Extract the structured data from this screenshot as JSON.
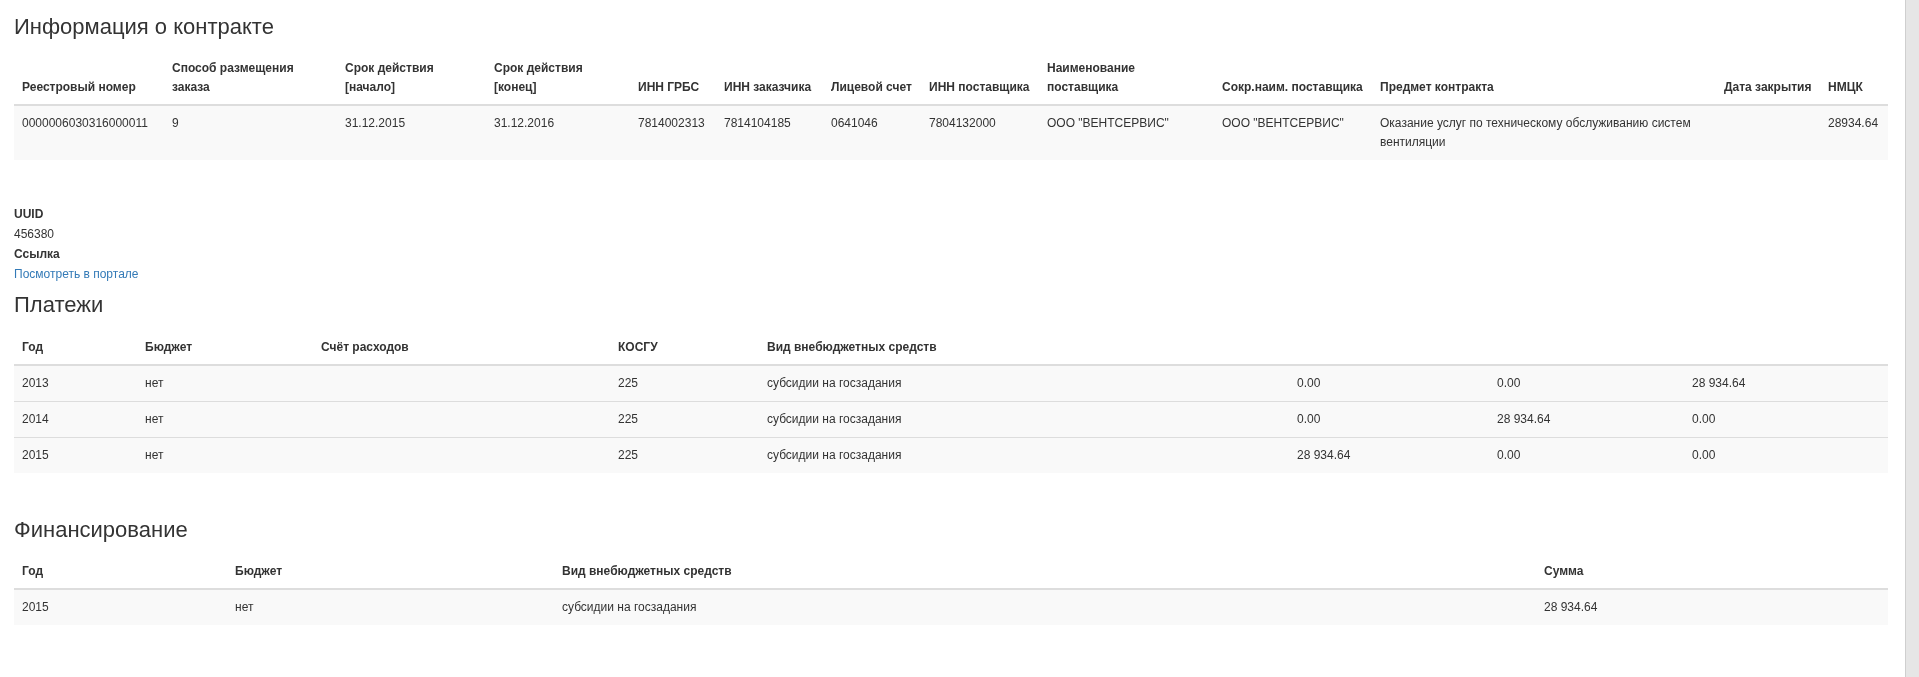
{
  "contract": {
    "title": "Информация о контракте",
    "columns": [
      "Реестровый номер",
      "Способ размещения заказа",
      "Срок действия [начало]",
      "Срок действия [конец]",
      "ИНН ГРБС",
      "ИНН заказчика",
      "Лицевой счет",
      "ИНН поставщика",
      "Наименование поставщика",
      "Сокр.наим. поставщика",
      "Предмет контракта",
      "Дата закрытия",
      "НМЦК"
    ],
    "rows": [
      [
        "0000006030316000011",
        "9",
        "31.12.2015",
        "31.12.2016",
        "7814002313",
        "7814104185",
        "0641046",
        "7804132000",
        "ООО \"ВЕНТСЕРВИС\"",
        "ООО \"ВЕНТСЕРВИС\"",
        "Оказание услуг по техническому обслуживанию систем вентиляции",
        null,
        "28934.64"
      ]
    ]
  },
  "details": [
    {
      "label": "UUID",
      "value": "456380",
      "kind": "text"
    },
    {
      "label": "Ссылка",
      "value": "Посмотреть в портале",
      "kind": "link"
    }
  ],
  "payments": {
    "title": "Платежи",
    "columns": [
      "Год",
      "Бюджет",
      "Счёт расходов",
      "КОСГУ",
      "Вид внебюджетных средств"
    ],
    "rows": [
      [
        "2013",
        "нет",
        null,
        "225",
        "субсидии на госзадания",
        "0.00",
        "0.00",
        "28 934.64"
      ],
      [
        "2014",
        "нет",
        null,
        "225",
        "субсидии на госзадания",
        "0.00",
        "28 934.64",
        "0.00"
      ],
      [
        "2015",
        "нет",
        null,
        "225",
        "субсидии на госзадания",
        "28 934.64",
        "0.00",
        "0.00"
      ]
    ]
  },
  "financing": {
    "title": "Финансирование",
    "columns": [
      "Год",
      "Бюджет",
      "Вид внебюджетных средств",
      "Сумма"
    ],
    "rows": [
      [
        "2015",
        "нет",
        "субсидии на госзадания",
        "28 934.64"
      ]
    ]
  }
}
